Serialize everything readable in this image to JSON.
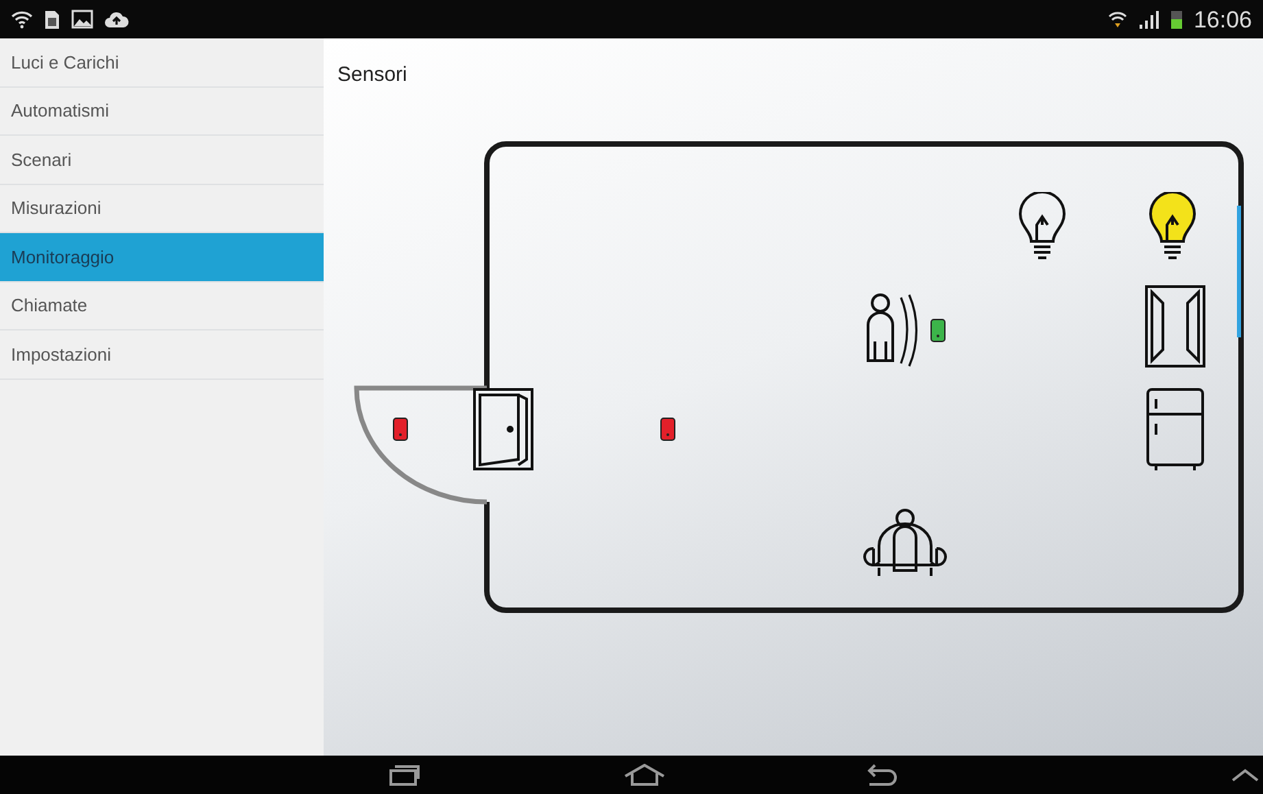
{
  "status_bar": {
    "time": "16:06"
  },
  "sidebar": {
    "items": [
      {
        "label": "Luci e Carichi",
        "selected": false
      },
      {
        "label": "Automatismi",
        "selected": false
      },
      {
        "label": "Scenari",
        "selected": false
      },
      {
        "label": "Misurazioni",
        "selected": false
      },
      {
        "label": "Monitoraggio",
        "selected": true
      },
      {
        "label": "Chiamate",
        "selected": false
      },
      {
        "label": "Impostazioni",
        "selected": false
      }
    ]
  },
  "main": {
    "title": "Sensori",
    "lights": [
      {
        "on": false
      },
      {
        "on": true
      }
    ],
    "sensors": [
      {
        "color": "#e3202a"
      },
      {
        "color": "#e3202a"
      },
      {
        "color": "#3cb44a"
      }
    ]
  }
}
